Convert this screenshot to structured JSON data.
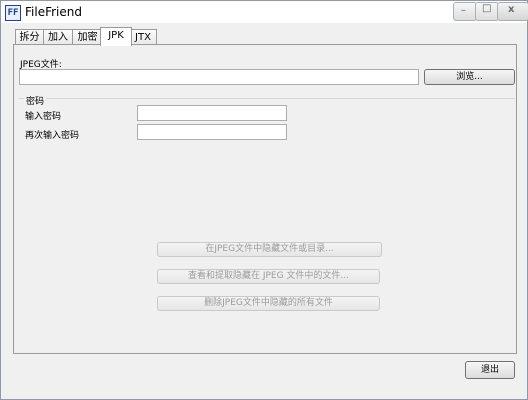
{
  "app": {
    "title": "FileFriend",
    "icon_text": "FF"
  },
  "window_controls": {
    "minimize": "–",
    "maximize": "□",
    "close": "x"
  },
  "tabs": [
    {
      "label": "拆分",
      "active": false
    },
    {
      "label": "加入",
      "active": false
    },
    {
      "label": "加密",
      "active": false
    },
    {
      "label": "JPK",
      "active": true
    },
    {
      "label": "JTX",
      "active": false
    }
  ],
  "jpk": {
    "jpeg_label": "JPEG文件:",
    "jpeg_value": "",
    "browse": "浏览...",
    "password_group": "密码",
    "password_label": "输入密码",
    "password_value": "",
    "confirm_label": "再次输入密码",
    "confirm_value": "",
    "actions": [
      "在JPEG文件中隐藏文件或目录...",
      "查看和提取隐藏在 JPEG 文件中的文件...",
      "删除JPEG文件中隐藏的所有文件"
    ]
  },
  "footer": {
    "exit": "退出"
  }
}
